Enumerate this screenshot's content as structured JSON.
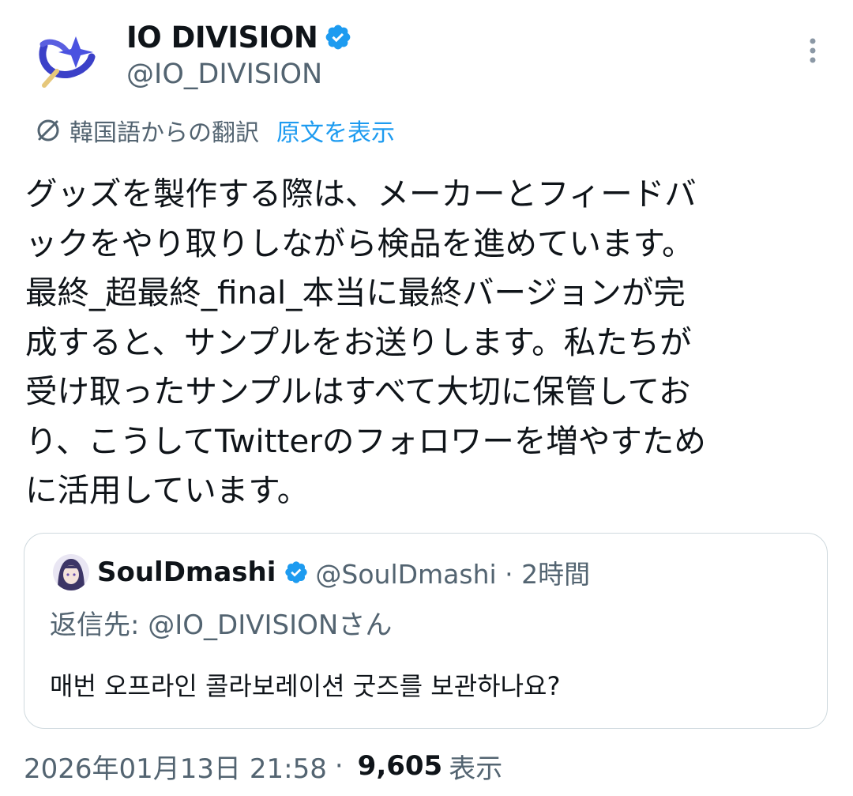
{
  "author": {
    "name": "IO DIVISION",
    "handle": "@IO_DIVISION",
    "verified": true,
    "avatar_icon": "sparkle-orbit-logo-icon"
  },
  "translation": {
    "label": "韓国語からの翻訳",
    "show_original": "原文を表示"
  },
  "body_lines": [
    "グッズを製作する際は、メーカーとフィードバ",
    "ックをやり取りしながら検品を進めています。",
    "最終_超最終_final_本当に最終バージョンが完",
    "成すると、サンプルをお送りします。私たちが",
    "受け取ったサンプルはすべて大切に保管してお",
    "り、こうしてTwitterのフォロワーを増やすため",
    "に活用しています。"
  ],
  "quoted": {
    "name": "SoulDmashi",
    "handle_time": "@SoulDmashi · 2時間",
    "reply_to": "返信先: @IO_DIVISIONさん",
    "text": "매번 오프라인 콜라보레이션 굿즈를 보관하나요?"
  },
  "meta": {
    "timestamp": "2026年01月13日 21:58",
    "separator": "·",
    "views_count": "9,605",
    "views_label": "表示"
  },
  "colors": {
    "primary_text": "#0f1419",
    "secondary_text": "#536471",
    "link": "#1d9bf0",
    "verified_badge": "#1d9bf0",
    "border": "#cfd9de"
  }
}
